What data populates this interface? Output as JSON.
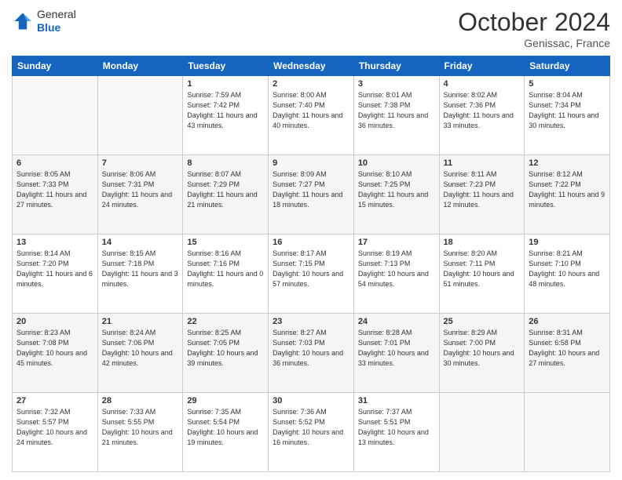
{
  "header": {
    "logo_line1": "General",
    "logo_line2": "Blue",
    "month": "October 2024",
    "location": "Genissac, France"
  },
  "weekdays": [
    "Sunday",
    "Monday",
    "Tuesday",
    "Wednesday",
    "Thursday",
    "Friday",
    "Saturday"
  ],
  "weeks": [
    [
      {
        "day": "",
        "sunrise": "",
        "sunset": "",
        "daylight": ""
      },
      {
        "day": "",
        "sunrise": "",
        "sunset": "",
        "daylight": ""
      },
      {
        "day": "1",
        "sunrise": "Sunrise: 7:59 AM",
        "sunset": "Sunset: 7:42 PM",
        "daylight": "Daylight: 11 hours and 43 minutes."
      },
      {
        "day": "2",
        "sunrise": "Sunrise: 8:00 AM",
        "sunset": "Sunset: 7:40 PM",
        "daylight": "Daylight: 11 hours and 40 minutes."
      },
      {
        "day": "3",
        "sunrise": "Sunrise: 8:01 AM",
        "sunset": "Sunset: 7:38 PM",
        "daylight": "Daylight: 11 hours and 36 minutes."
      },
      {
        "day": "4",
        "sunrise": "Sunrise: 8:02 AM",
        "sunset": "Sunset: 7:36 PM",
        "daylight": "Daylight: 11 hours and 33 minutes."
      },
      {
        "day": "5",
        "sunrise": "Sunrise: 8:04 AM",
        "sunset": "Sunset: 7:34 PM",
        "daylight": "Daylight: 11 hours and 30 minutes."
      }
    ],
    [
      {
        "day": "6",
        "sunrise": "Sunrise: 8:05 AM",
        "sunset": "Sunset: 7:33 PM",
        "daylight": "Daylight: 11 hours and 27 minutes."
      },
      {
        "day": "7",
        "sunrise": "Sunrise: 8:06 AM",
        "sunset": "Sunset: 7:31 PM",
        "daylight": "Daylight: 11 hours and 24 minutes."
      },
      {
        "day": "8",
        "sunrise": "Sunrise: 8:07 AM",
        "sunset": "Sunset: 7:29 PM",
        "daylight": "Daylight: 11 hours and 21 minutes."
      },
      {
        "day": "9",
        "sunrise": "Sunrise: 8:09 AM",
        "sunset": "Sunset: 7:27 PM",
        "daylight": "Daylight: 11 hours and 18 minutes."
      },
      {
        "day": "10",
        "sunrise": "Sunrise: 8:10 AM",
        "sunset": "Sunset: 7:25 PM",
        "daylight": "Daylight: 11 hours and 15 minutes."
      },
      {
        "day": "11",
        "sunrise": "Sunrise: 8:11 AM",
        "sunset": "Sunset: 7:23 PM",
        "daylight": "Daylight: 11 hours and 12 minutes."
      },
      {
        "day": "12",
        "sunrise": "Sunrise: 8:12 AM",
        "sunset": "Sunset: 7:22 PM",
        "daylight": "Daylight: 11 hours and 9 minutes."
      }
    ],
    [
      {
        "day": "13",
        "sunrise": "Sunrise: 8:14 AM",
        "sunset": "Sunset: 7:20 PM",
        "daylight": "Daylight: 11 hours and 6 minutes."
      },
      {
        "day": "14",
        "sunrise": "Sunrise: 8:15 AM",
        "sunset": "Sunset: 7:18 PM",
        "daylight": "Daylight: 11 hours and 3 minutes."
      },
      {
        "day": "15",
        "sunrise": "Sunrise: 8:16 AM",
        "sunset": "Sunset: 7:16 PM",
        "daylight": "Daylight: 11 hours and 0 minutes."
      },
      {
        "day": "16",
        "sunrise": "Sunrise: 8:17 AM",
        "sunset": "Sunset: 7:15 PM",
        "daylight": "Daylight: 10 hours and 57 minutes."
      },
      {
        "day": "17",
        "sunrise": "Sunrise: 8:19 AM",
        "sunset": "Sunset: 7:13 PM",
        "daylight": "Daylight: 10 hours and 54 minutes."
      },
      {
        "day": "18",
        "sunrise": "Sunrise: 8:20 AM",
        "sunset": "Sunset: 7:11 PM",
        "daylight": "Daylight: 10 hours and 51 minutes."
      },
      {
        "day": "19",
        "sunrise": "Sunrise: 8:21 AM",
        "sunset": "Sunset: 7:10 PM",
        "daylight": "Daylight: 10 hours and 48 minutes."
      }
    ],
    [
      {
        "day": "20",
        "sunrise": "Sunrise: 8:23 AM",
        "sunset": "Sunset: 7:08 PM",
        "daylight": "Daylight: 10 hours and 45 minutes."
      },
      {
        "day": "21",
        "sunrise": "Sunrise: 8:24 AM",
        "sunset": "Sunset: 7:06 PM",
        "daylight": "Daylight: 10 hours and 42 minutes."
      },
      {
        "day": "22",
        "sunrise": "Sunrise: 8:25 AM",
        "sunset": "Sunset: 7:05 PM",
        "daylight": "Daylight: 10 hours and 39 minutes."
      },
      {
        "day": "23",
        "sunrise": "Sunrise: 8:27 AM",
        "sunset": "Sunset: 7:03 PM",
        "daylight": "Daylight: 10 hours and 36 minutes."
      },
      {
        "day": "24",
        "sunrise": "Sunrise: 8:28 AM",
        "sunset": "Sunset: 7:01 PM",
        "daylight": "Daylight: 10 hours and 33 minutes."
      },
      {
        "day": "25",
        "sunrise": "Sunrise: 8:29 AM",
        "sunset": "Sunset: 7:00 PM",
        "daylight": "Daylight: 10 hours and 30 minutes."
      },
      {
        "day": "26",
        "sunrise": "Sunrise: 8:31 AM",
        "sunset": "Sunset: 6:58 PM",
        "daylight": "Daylight: 10 hours and 27 minutes."
      }
    ],
    [
      {
        "day": "27",
        "sunrise": "Sunrise: 7:32 AM",
        "sunset": "Sunset: 5:57 PM",
        "daylight": "Daylight: 10 hours and 24 minutes."
      },
      {
        "day": "28",
        "sunrise": "Sunrise: 7:33 AM",
        "sunset": "Sunset: 5:55 PM",
        "daylight": "Daylight: 10 hours and 21 minutes."
      },
      {
        "day": "29",
        "sunrise": "Sunrise: 7:35 AM",
        "sunset": "Sunset: 5:54 PM",
        "daylight": "Daylight: 10 hours and 19 minutes."
      },
      {
        "day": "30",
        "sunrise": "Sunrise: 7:36 AM",
        "sunset": "Sunset: 5:52 PM",
        "daylight": "Daylight: 10 hours and 16 minutes."
      },
      {
        "day": "31",
        "sunrise": "Sunrise: 7:37 AM",
        "sunset": "Sunset: 5:51 PM",
        "daylight": "Daylight: 10 hours and 13 minutes."
      },
      {
        "day": "",
        "sunrise": "",
        "sunset": "",
        "daylight": ""
      },
      {
        "day": "",
        "sunrise": "",
        "sunset": "",
        "daylight": ""
      }
    ]
  ]
}
